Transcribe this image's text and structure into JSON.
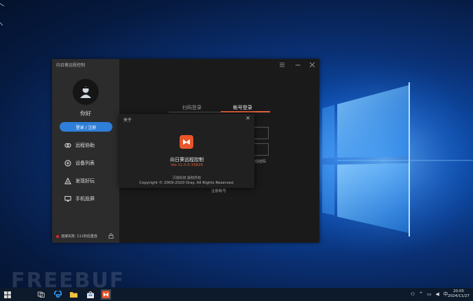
{
  "app": {
    "title": "向日葵远程控制",
    "greeting": "你好",
    "login_label": "登录 / 注册",
    "nav": [
      {
        "label": "远程协助",
        "icon": "remote-assist-icon"
      },
      {
        "label": "设备列表",
        "icon": "device-list-icon"
      },
      {
        "label": "发现好玩",
        "icon": "discover-icon"
      },
      {
        "label": "手机投屏",
        "icon": "phone-cast-icon"
      }
    ],
    "status_text": "连接失败: 111秒后重连",
    "tabs": {
      "qr": "扫码登录",
      "account": "帐号登录"
    },
    "remember_label": "记住密码",
    "register_label": "注册帐号",
    "accent_color": "#e0613a"
  },
  "about": {
    "title": "关于",
    "app_name": "向日葵远程控制",
    "version": "Ver.11.0.0.33826",
    "company": "贝锐科技 版权所有",
    "copyright": "Copyright © 2009-2020 Oray. All Rights Reserved."
  },
  "watermark": "FREEBUF",
  "taskbar": {
    "time": "20:05",
    "date": "2024/11/27"
  }
}
